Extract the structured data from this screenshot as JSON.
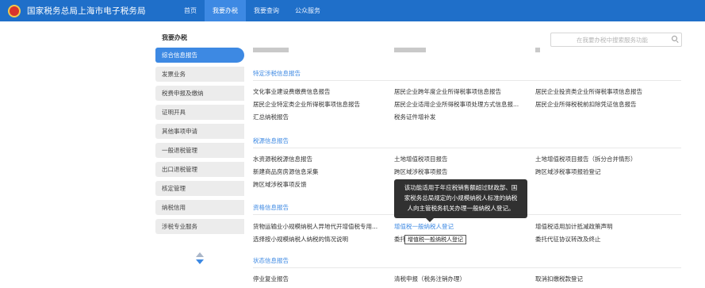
{
  "header": {
    "title": "国家税务总局上海市电子税务局",
    "nav": [
      {
        "label": "首页",
        "active": false
      },
      {
        "label": "我要办税",
        "active": true
      },
      {
        "label": "我要查询",
        "active": false
      },
      {
        "label": "公众服务",
        "active": false
      }
    ]
  },
  "sidebar": {
    "title": "我要办税",
    "items": [
      {
        "label": "综合信息报告",
        "active": true
      },
      {
        "label": "发票业务"
      },
      {
        "label": "税费申报及缴纳"
      },
      {
        "label": "证明开具"
      },
      {
        "label": "其他事项申请"
      },
      {
        "label": "一般退税管理"
      },
      {
        "label": "出口退税管理"
      },
      {
        "label": "核定管理"
      },
      {
        "label": "纳税信用"
      },
      {
        "label": "涉税专业服务"
      }
    ]
  },
  "search": {
    "placeholder": "在我要办税中搜索服务功能"
  },
  "sections": [
    {
      "title": "特定涉税信息报告",
      "rows": [
        [
          "文化事业建设费缴费信息报告",
          "居民企业跨年度企业所得税事项信息报告",
          "居民企业投资类企业所得税事项信息报告"
        ],
        [
          "居民企业特定类企业所得税事项信息报告",
          "居民企业适用企业所得税事项处理方式信息报...",
          "居民企业所得税税前扣除凭证信息报告"
        ],
        [
          "汇总纳税报告",
          "税务证件增补发",
          ""
        ]
      ]
    },
    {
      "title": "税源信息报告",
      "rows": [
        [
          "水资源税税源信息报告",
          "土地增值税项目报告",
          "土地增值税项目报告（拆分合并情形）"
        ],
        [
          "新建商品房房源信息采集",
          "跨区域涉税事项报告",
          "跨区域涉税事项报验登记"
        ],
        [
          "跨区域涉税事项反馈",
          "",
          ""
        ]
      ]
    },
    {
      "title": "资格信息报告",
      "rows": [
        [
          "货物运输业小规模纳税人异地代开增值税专用...",
          "增值税一般纳税人登记",
          "增值税适用加计抵减政策声明"
        ],
        [
          "选择按小规模纳税人纳税的情况说明",
          "委托",
          "委托代征协议转改及终止"
        ]
      ]
    },
    {
      "title": "状态信息报告",
      "rows": [
        [
          "停业复业报告",
          "清税申报（税务注销办理）",
          "取消扣缴税款登记"
        ]
      ]
    }
  ],
  "tooltip": {
    "lines": [
      "该功能适用于年应税销售额超过财政部、国",
      "家税务总局规定的小规模纳税人标准的纳税",
      "人向主管税务机关办理一般纳税人登记。"
    ]
  },
  "hover_tip": "增值税一般纳税人登记",
  "colors": {
    "header": "#1f6fc9",
    "accent": "#3d89e3",
    "sidebar_item": "#ececec"
  }
}
